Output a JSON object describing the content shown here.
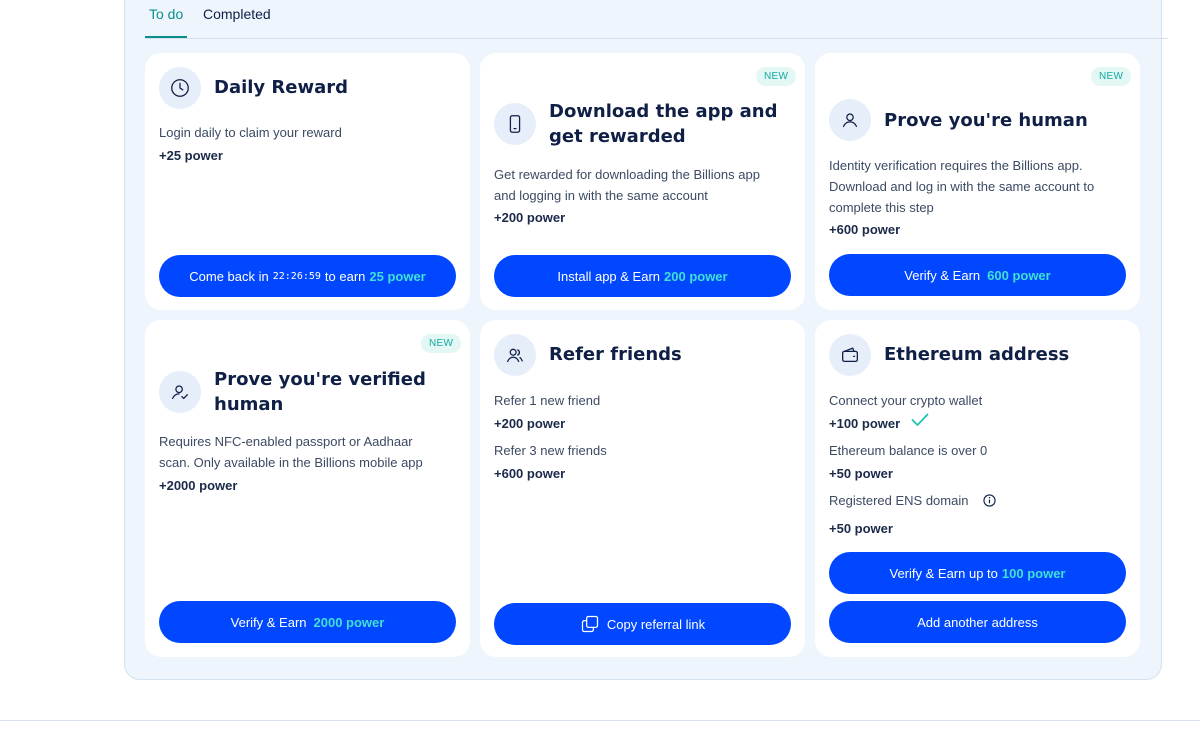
{
  "tabs": {
    "todo": "To do",
    "completed": "Completed"
  },
  "cards": {
    "daily": {
      "title": "Daily Reward",
      "desc": "Login daily to claim your reward",
      "power": "+25 power",
      "btn_pre": "Come back in",
      "btn_timer": "22:26:59",
      "btn_mid": "to earn",
      "btn_accent": "25 power",
      "icon": "clock-icon"
    },
    "download": {
      "badge": "NEW",
      "title_l1": "Download the app and",
      "title_l2": "get rewarded",
      "desc_l1": "Get rewarded for downloading the Billions app",
      "desc_l2": "and logging in with the same account",
      "power": "+200 power",
      "btn": "Install app & Earn",
      "btn_accent": "200 power",
      "icon": "phone-icon"
    },
    "human": {
      "badge": "NEW",
      "title": "Prove you're human",
      "desc_l1": "Identity verification requires the Billions app.",
      "desc_l2": "Download and log in with the same account to",
      "desc_l3": "complete this step",
      "power": "+600 power",
      "btn": "Verify & Earn",
      "btn_accent": "600 power",
      "icon": "user-icon"
    },
    "verified": {
      "badge": "NEW",
      "title_l1": "Prove you're verified",
      "title_l2": "human",
      "desc_l1": "Requires NFC-enabled passport or Aadhaar",
      "desc_l2": "scan. Only available in the Billions mobile app",
      "power": "+2000 power",
      "btn": "Verify & Earn",
      "btn_accent": "2000 power",
      "icon": "user-check-icon"
    },
    "refer": {
      "title": "Refer friends",
      "item1": "Refer 1 new friend",
      "power1": "+200 power",
      "item2": "Refer 3 new friends",
      "power2": "+600 power",
      "btn": "Copy referral link",
      "icon": "users-icon"
    },
    "eth": {
      "title": "Ethereum address",
      "item1": "Connect your crypto wallet",
      "power1": "+100 power",
      "item2": "Ethereum balance is over 0",
      "power2": "+50 power",
      "item3": "Registered ENS domain",
      "power3": "+50 power",
      "btn1": "Verify & Earn up to",
      "btn1_accent": "100 power",
      "btn2": "Add another address",
      "icon": "wallet-icon"
    }
  },
  "colors": {
    "accent_teal": "#0a8f8c",
    "button_blue": "#0047ff",
    "button_accent": "#3fe0d6",
    "panel_bg": "#eef5fd"
  }
}
